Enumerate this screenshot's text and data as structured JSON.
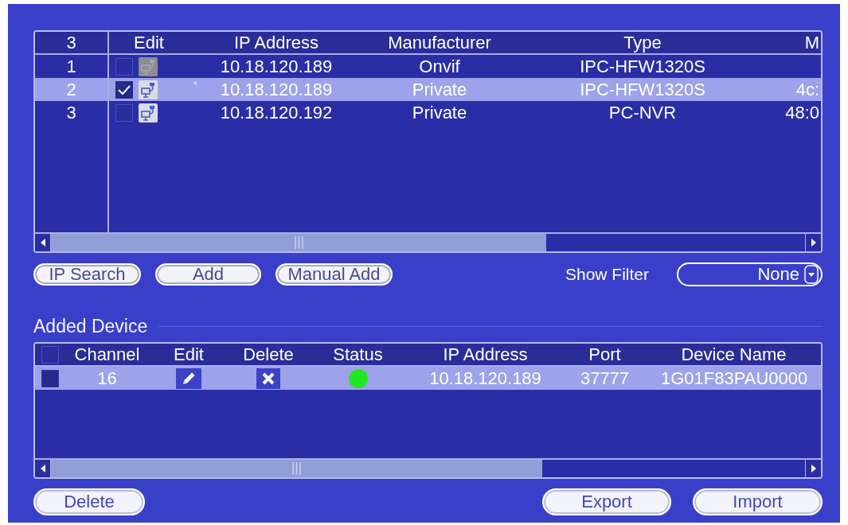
{
  "device_list": {
    "columns": [
      "3",
      "Edit",
      "IP Address",
      "Manufacturer",
      "Type",
      "M"
    ],
    "rows": [
      {
        "index": "1",
        "selected": false,
        "checked": false,
        "edit_disabled": true,
        "ip": "10.18.120.189",
        "manufacturer": "Onvif",
        "type": "IPC-HFW1320S"
      },
      {
        "index": "2",
        "selected": true,
        "checked": true,
        "edit_disabled": false,
        "marker": "*",
        "ip": "10.18.120.189",
        "manufacturer": "Private",
        "type": "IPC-HFW1320S",
        "column_6": "4c:"
      },
      {
        "index": "3",
        "selected": false,
        "checked": false,
        "edit_disabled": false,
        "ip": "10.18.120.192",
        "manufacturer": "Private",
        "type": "PC-NVR",
        "column_6": "48:0"
      }
    ]
  },
  "search_buttons": [
    "IP Search",
    "Add",
    "Manual Add"
  ],
  "show_filter": {
    "label": "Show Filter",
    "value": "None"
  },
  "added_device": {
    "title": "Added Device",
    "header_checked": false,
    "columns": [
      "Channel",
      "Edit",
      "Delete",
      "Status",
      "IP Address",
      "Port",
      "Device Name"
    ],
    "rows": [
      {
        "selected": true,
        "checked": false,
        "channel": "16",
        "color": "#22e622",
        "ip": "10.18.120.189",
        "port": "37777",
        "device_name": "1G01F83PAU0000"
      }
    ]
  },
  "left_buttons": [
    "Delete"
  ],
  "right_buttons": [
    "Export",
    "Import"
  ]
}
